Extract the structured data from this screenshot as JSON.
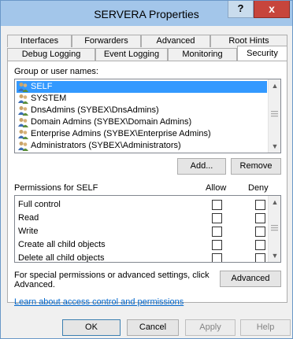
{
  "window": {
    "title": "SERVERA Properties",
    "help_glyph": "?",
    "close_glyph": "x"
  },
  "tabs": {
    "row1": [
      {
        "label": "Interfaces"
      },
      {
        "label": "Forwarders"
      },
      {
        "label": "Advanced"
      },
      {
        "label": "Root Hints"
      }
    ],
    "row2": [
      {
        "label": "Debug Logging"
      },
      {
        "label": "Event Logging"
      },
      {
        "label": "Monitoring"
      },
      {
        "label": "Security",
        "active": true
      }
    ]
  },
  "security": {
    "group_label": "Group or user names:",
    "users": [
      {
        "name": "SELF",
        "selected": true
      },
      {
        "name": "SYSTEM"
      },
      {
        "name": "DnsAdmins (SYBEX\\DnsAdmins)"
      },
      {
        "name": "Domain Admins (SYBEX\\Domain Admins)"
      },
      {
        "name": "Enterprise Admins (SYBEX\\Enterprise Admins)"
      },
      {
        "name": "Administrators (SYBEX\\Administrators)"
      }
    ],
    "add_label": "Add...",
    "remove_label": "Remove",
    "permissions_for": "Permissions for SELF",
    "allow_header": "Allow",
    "deny_header": "Deny",
    "permissions": [
      {
        "name": "Full control",
        "allow": false,
        "deny": false
      },
      {
        "name": "Read",
        "allow": false,
        "deny": false
      },
      {
        "name": "Write",
        "allow": false,
        "deny": false
      },
      {
        "name": "Create all child objects",
        "allow": false,
        "deny": false
      },
      {
        "name": "Delete all child objects",
        "allow": false,
        "deny": false
      }
    ],
    "special_text_1": "For special permissions or advanced settings, click",
    "special_text_2": "Advanced.",
    "advanced_label": "Advanced",
    "learn_link": "Learn about access control and permissions"
  },
  "footer": {
    "ok_label": "OK",
    "cancel_label": "Cancel",
    "apply_label": "Apply",
    "help_label": "Help"
  }
}
